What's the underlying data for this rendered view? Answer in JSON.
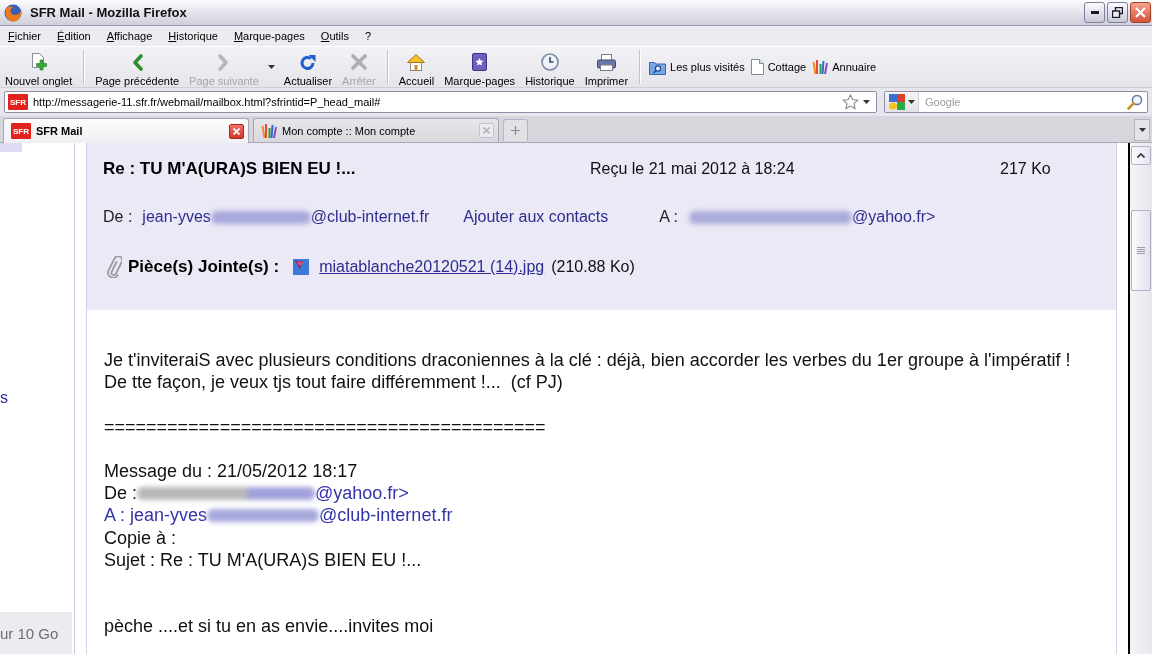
{
  "window": {
    "title": "SFR Mail - Mozilla Firefox"
  },
  "menu_bar": [
    {
      "label": "Fichier"
    },
    {
      "label": "Édition"
    },
    {
      "label": "Affichage"
    },
    {
      "label": "Historique"
    },
    {
      "label": "Marque-pages"
    },
    {
      "label": "Outils"
    },
    {
      "label": "?"
    }
  ],
  "toolbar": {
    "groups": [
      {
        "buttons": [
          {
            "kind": "new_tab",
            "label": "Nouvel onglet",
            "disabled": false
          }
        ]
      },
      {
        "buttons": [
          {
            "kind": "back",
            "label": "Page précédente",
            "disabled": false
          },
          {
            "kind": "forward",
            "label": "Page suivante",
            "disabled": true
          },
          {
            "kind": "history_menu",
            "disabled": false
          },
          {
            "kind": "reload",
            "label": "Actualiser",
            "disabled": false
          },
          {
            "kind": "stop",
            "label": "Arrêter",
            "disabled": true
          }
        ]
      },
      {
        "buttons": [
          {
            "kind": "home",
            "label": "Accueil",
            "disabled": false
          },
          {
            "kind": "bookmarks",
            "label": "Marque-pages",
            "disabled": false
          },
          {
            "kind": "history",
            "label": "Historique",
            "disabled": false
          },
          {
            "kind": "print",
            "label": "Imprimer",
            "disabled": false
          }
        ]
      }
    ],
    "bookmarks": [
      {
        "kind": "smart_folder",
        "label": "Les plus visités"
      },
      {
        "kind": "page",
        "label": "Cottage"
      },
      {
        "kind": "directory",
        "label": "Annuaire"
      }
    ]
  },
  "address_bar": {
    "site_icon_text": "SFR",
    "url": "http://messagerie-11.sfr.fr/webmail/mailbox.html?sfrintid=P_head_mail#",
    "bookmarked": false
  },
  "search": {
    "placeholder": "Google"
  },
  "tabs": [
    {
      "title": "SFR Mail",
      "selected": true,
      "icon": {
        "kind": "logo",
        "text": "SFR"
      }
    },
    {
      "title": "Mon compte :: Mon compte",
      "selected": false,
      "icon": {
        "kind": "bars"
      }
    }
  ],
  "sidebar": {
    "link_fragment": "s",
    "quota_fragment": "ur 10 Go"
  },
  "message": {
    "subject": "Re : TU M'A(URA)S BIEN EU !...",
    "received": "Reçu le 21 mai 2012 à 18:24",
    "size": "217 Ko",
    "from": {
      "label": "De :",
      "address": {
        "before": "jean-yves",
        "redacted": true,
        "after": "@club-internet.fr"
      }
    },
    "add_contact": "Ajouter aux contacts",
    "to": {
      "label": "A :",
      "address": {
        "redacted": true,
        "after": "@yahoo.fr>"
      }
    },
    "attachments": {
      "label": "Pièce(s) Jointe(s) :",
      "files": [
        {
          "name": "miatablanche20120521 (14).jpg",
          "size": "(210.88 Ko)"
        }
      ]
    },
    "body": [
      {
        "kind": "paragraph",
        "lines": [
          "Je t'inviteraiS avec plusieurs conditions draconiennes à la clé : déjà, bien accorder les verbes du 1er groupe à l'impératif !",
          "De tte façon, je veux tjs tout faire différemment !...  (cf PJ)"
        ]
      },
      {
        "kind": "rule",
        "text": "=========================================="
      },
      {
        "kind": "quote",
        "lines": [
          {
            "kind": "plain",
            "text": "Message du : 21/05/2012 18:17"
          },
          {
            "kind": "address",
            "label": "De :",
            "label_linked": false,
            "address": {
              "redacted": true,
              "after": "@yahoo.fr>"
            }
          },
          {
            "kind": "address",
            "label": "A :",
            "label_linked": true,
            "address": {
              "before": "jean-yves",
              "redacted": true,
              "after": "@club-internet.fr"
            }
          },
          {
            "kind": "plain",
            "text": "Copie à :"
          },
          {
            "kind": "plain",
            "text": "Sujet : Re : TU M'A(URA)S BIEN EU !..."
          }
        ]
      },
      {
        "kind": "paragraph",
        "lines": [
          "pèche ....et si tu en as envie....invites moi"
        ]
      }
    ]
  }
}
